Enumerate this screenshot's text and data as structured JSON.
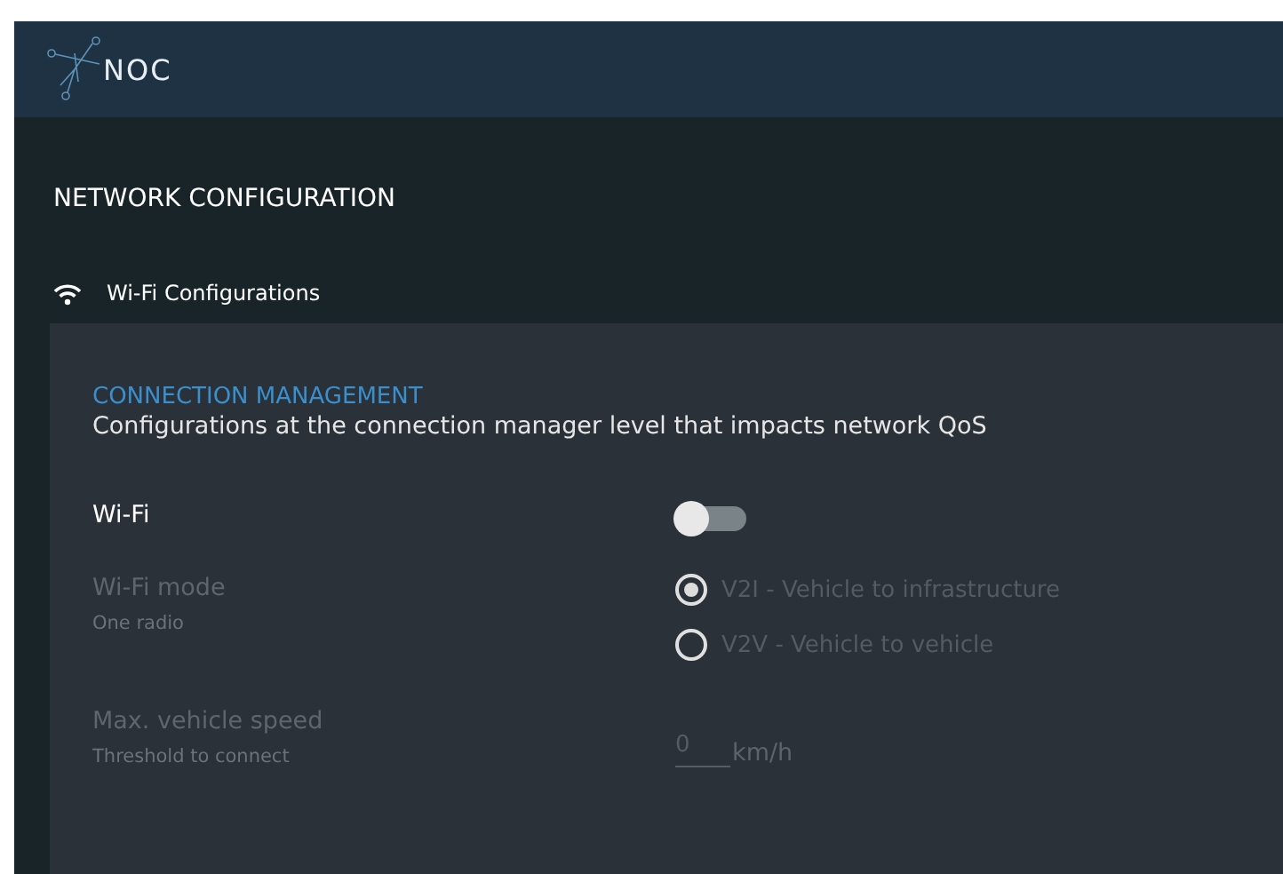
{
  "header": {
    "logo_text": "NOC"
  },
  "page_title": "NETWORK CONFIGURATION",
  "section_tab": {
    "label": "Wi-Fi Configurations"
  },
  "panel": {
    "heading": "CONNECTION MANAGEMENT",
    "description": "Configurations at the connection manager level that impacts network QoS",
    "settings": [
      {
        "kind": "toggle",
        "label": "Wi-Fi",
        "disabled": false,
        "on": false
      },
      {
        "kind": "radio",
        "label": "Wi-Fi mode",
        "hint": "One radio",
        "disabled": true,
        "options": [
          {
            "label": "V2I - Vehicle to infrastructure",
            "selected": true
          },
          {
            "label": "V2V - Vehicle to vehicle",
            "selected": false
          }
        ]
      },
      {
        "kind": "number",
        "label": "Max. vehicle speed",
        "hint": "Threshold to connect",
        "disabled": true,
        "value": "0",
        "unit": "km/h"
      }
    ]
  }
}
